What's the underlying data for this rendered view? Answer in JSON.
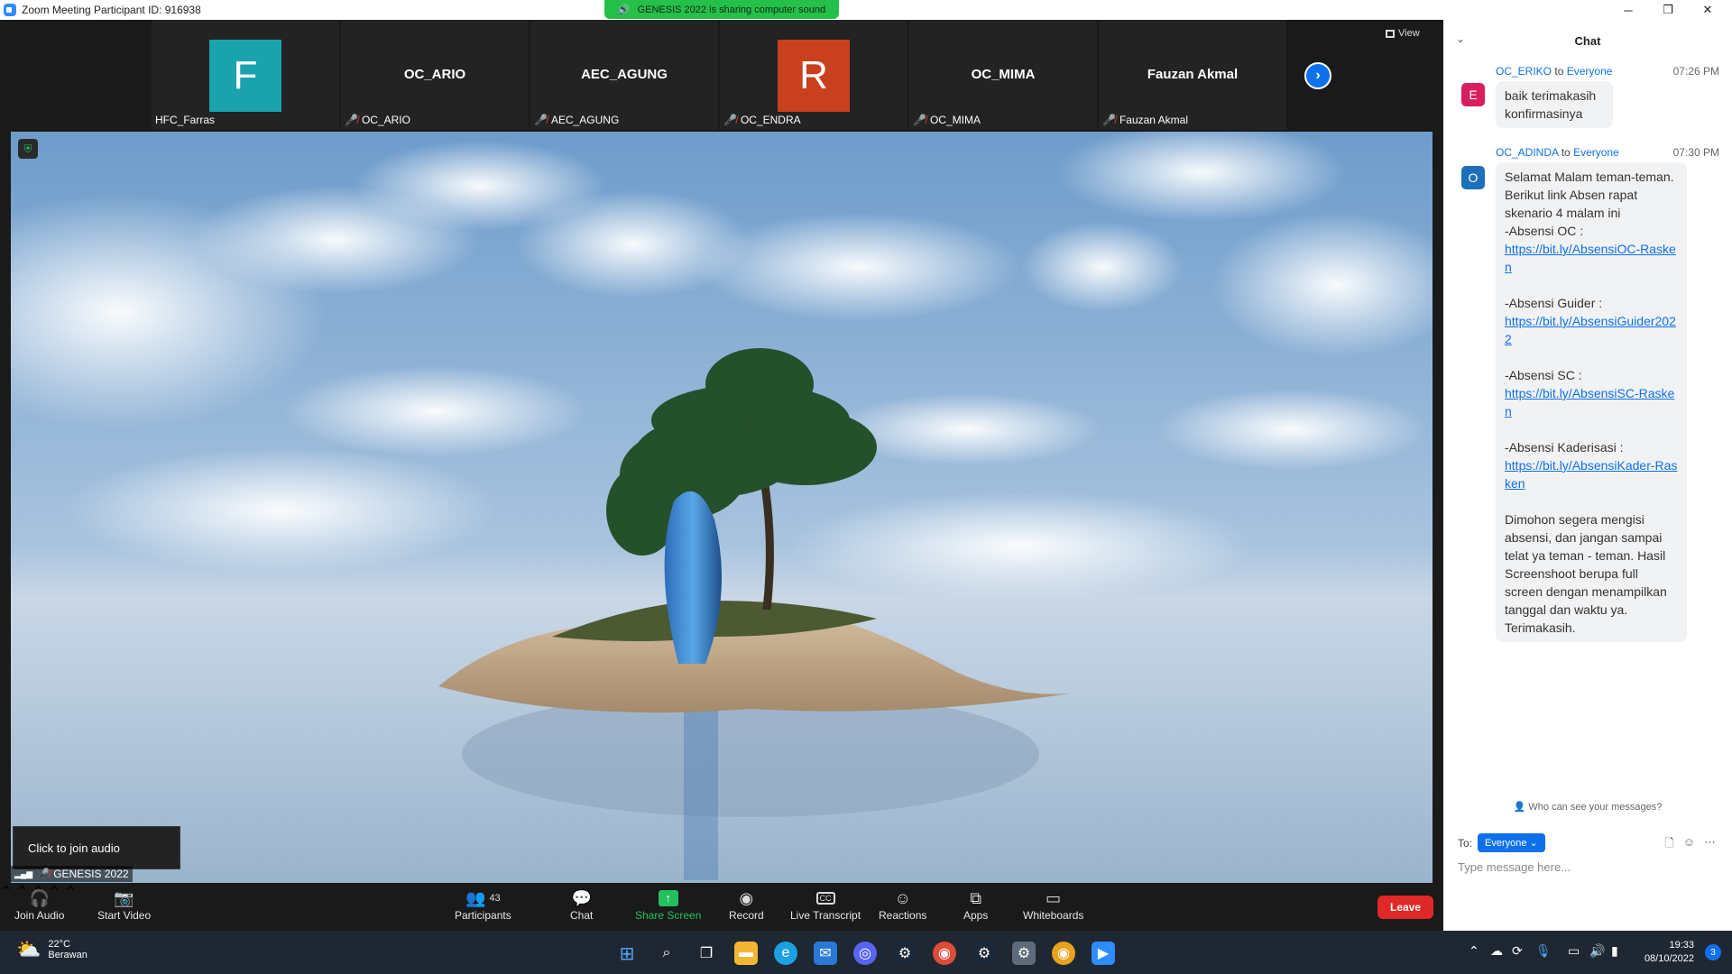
{
  "window": {
    "title": "Zoom Meeting Participant ID: 916938",
    "share_banner": "GENESIS 2022 is sharing computer sound"
  },
  "participants": [
    {
      "display": "F",
      "name": "HFC_Farras",
      "avatar_color": "#1aa3ad",
      "muted": false
    },
    {
      "display": "OC_ARIO",
      "name": "OC_ARIO",
      "muted": true
    },
    {
      "display": "AEC_AGUNG",
      "name": "AEC_AGUNG",
      "muted": true
    },
    {
      "display": "R",
      "name": "OC_ENDRA",
      "avatar_color": "#c8401e",
      "muted": true
    },
    {
      "display": "OC_MIMA",
      "name": "OC_MIMA",
      "muted": true
    },
    {
      "display": "Fauzan  Akmal",
      "name": "Fauzan  Akmal",
      "muted": true
    }
  ],
  "view_label": "View",
  "join_audio_popup": "Click to join audio",
  "host_label": "GENESIS 2022",
  "toolbar": {
    "join_audio": "Join Audio",
    "start_video": "Start Video",
    "participants": "Participants",
    "participants_count": "43",
    "chat": "Chat",
    "share_screen": "Share Screen",
    "record": "Record",
    "live_transcript": "Live Transcript",
    "reactions": "Reactions",
    "apps": "Apps",
    "whiteboards": "Whiteboards",
    "leave": "Leave"
  },
  "chat": {
    "header": "Chat",
    "messages": [
      {
        "sender": "OC_ERIKO",
        "to_word": "to",
        "recipient": "Everyone",
        "time": "07:26 PM",
        "avatar": "E",
        "avatar_color": "#d81e5b",
        "text": "baik terimakasih konfirmasinya"
      },
      {
        "sender": "OC_ADINDA",
        "to_word": "to",
        "recipient": "Everyone",
        "time": "07:30 PM",
        "avatar": "O",
        "avatar_color": "#1e6fb9",
        "intro": "Selamat Malam teman-teman. Berikut link Absen rapat skenario 4 malam ini",
        "oc_label": "-Absensi OC :",
        "oc_link": "https://bit.ly/AbsensiOC-Rasken",
        "guider_label": "-Absensi Guider :",
        "guider_link": "https://bit.ly/AbsensiGuider2022",
        "sc_label": "-Absensi SC :",
        "sc_link": "https://bit.ly/AbsensiSC-Rasken",
        "kader_label": "-Absensi Kaderisasi :",
        "kader_link": "https://bit.ly/AbsensiKader-Rasken",
        "closing": "Dimohon segera mengisi absensi, dan jangan sampai telat ya teman - teman. Hasil Screenshoot berupa full screen dengan menampilkan tanggal dan waktu ya. Terimakasih."
      }
    ],
    "who_can_see": "Who can see your messages?",
    "to_label": "To:",
    "to_value": "Everyone",
    "placeholder": "Type message here..."
  },
  "taskbar": {
    "temperature": "22°C",
    "weather": "Berawan",
    "time": "19:33",
    "date": "08/10/2022",
    "notifications": "3"
  }
}
